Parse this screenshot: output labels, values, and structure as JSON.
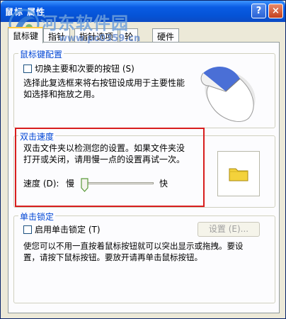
{
  "window": {
    "title": "鼠标 属性",
    "help_label": "?",
    "close_label": "×"
  },
  "watermark": {
    "name": "河东软件园",
    "url": "www.pc0359.cn"
  },
  "tabs": [
    {
      "label": "鼠标键",
      "active": true
    },
    {
      "label": "指针",
      "active": false
    },
    {
      "label": "指针选项",
      "active": false
    },
    {
      "label": "轮",
      "active": false
    },
    {
      "label": "硬件",
      "active": false
    }
  ],
  "button_config": {
    "legend": "鼠标键配置",
    "checkbox_label": "切换主要和次要的按钮 (S)",
    "checked": false,
    "description_line1": "选择此复选框来将右按钮设成用于主要性能",
    "description_line2": "如选择和拖放之用。"
  },
  "double_click": {
    "legend": "双击速度",
    "description_line1": "双击文件夹以检测您的设置。如果文件夹没",
    "description_line2": "打开或关闭，请用慢一点的设置再试一次。",
    "speed_label": "速度 (D):",
    "slow_label": "慢",
    "fast_label": "快",
    "slider_value_fraction": 0.02
  },
  "click_lock": {
    "legend": "单击锁定",
    "checkbox_label": "启用单击锁定 (T)",
    "checked": false,
    "settings_button": "设置 (E)...",
    "description_line1": "使您可以不用一直按着鼠标按钮就可以突出显示或拖拽。要设",
    "description_line2": "置，请按下鼠标按钮。要放开请再单击鼠标按钮。"
  },
  "colors": {
    "legend_blue": "#0046d5",
    "highlight_red": "#d81e1e",
    "folder_yellow": "#f4d23b"
  }
}
